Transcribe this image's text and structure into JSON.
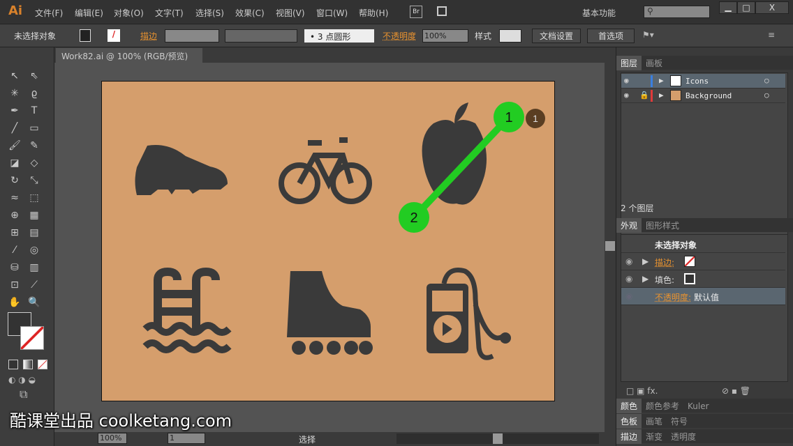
{
  "app": {
    "logo": "Ai",
    "menus": [
      "文件(F)",
      "编辑(E)",
      "对象(O)",
      "文字(T)",
      "选择(S)",
      "效果(C)",
      "视图(V)",
      "窗口(W)",
      "帮助(H)"
    ],
    "bridge": "Br",
    "workspace": "基本功能",
    "window_controls": [
      "minimize",
      "maximize",
      "X"
    ]
  },
  "control": {
    "selection": "未选择对象",
    "stroke_label": "描边",
    "brush": "3 点圆形",
    "opacity_label": "不透明度",
    "opacity": "100%",
    "style_label": "样式",
    "doc_setup": "文档设置",
    "prefs": "首选项"
  },
  "document": {
    "tab": "Work82.ai @ 100% (RGB/预览)",
    "close": "×"
  },
  "overlay": {
    "start": "1",
    "end": "2",
    "badge": "1",
    "accent": "#22cc22",
    "badge_color": "#5a3e22"
  },
  "artboard": {
    "color": "#d59e6c",
    "icons": [
      "shoe-icon",
      "bicycle-icon",
      "apple-icon",
      "pool-ladder-icon",
      "roller-skate-icon",
      "music-player-icon"
    ]
  },
  "status": {
    "zoom": "100%",
    "page": "1",
    "tool": "选择"
  },
  "layers": {
    "tabs": [
      "图层",
      "画板"
    ],
    "items": [
      {
        "name": "Icons",
        "color": "#3a7fe0",
        "locked": false
      },
      {
        "name": "Background",
        "color": "#e03a3a",
        "locked": true
      }
    ],
    "count": "2 个图层"
  },
  "appearance": {
    "tabs": [
      "外观",
      "图形样式"
    ],
    "title": "未选择对象",
    "stroke": "描边:",
    "fill": "填色:",
    "opacity": "不透明度:",
    "opacity_value": "默认值"
  },
  "collapsed_panels": [
    [
      "颜色",
      "颜色参考",
      "Kuler"
    ],
    [
      "色板",
      "画笔",
      "符号"
    ],
    [
      "描边",
      "渐变",
      "透明度"
    ]
  ],
  "watermark": "酷课堂出品 coolketang.com"
}
